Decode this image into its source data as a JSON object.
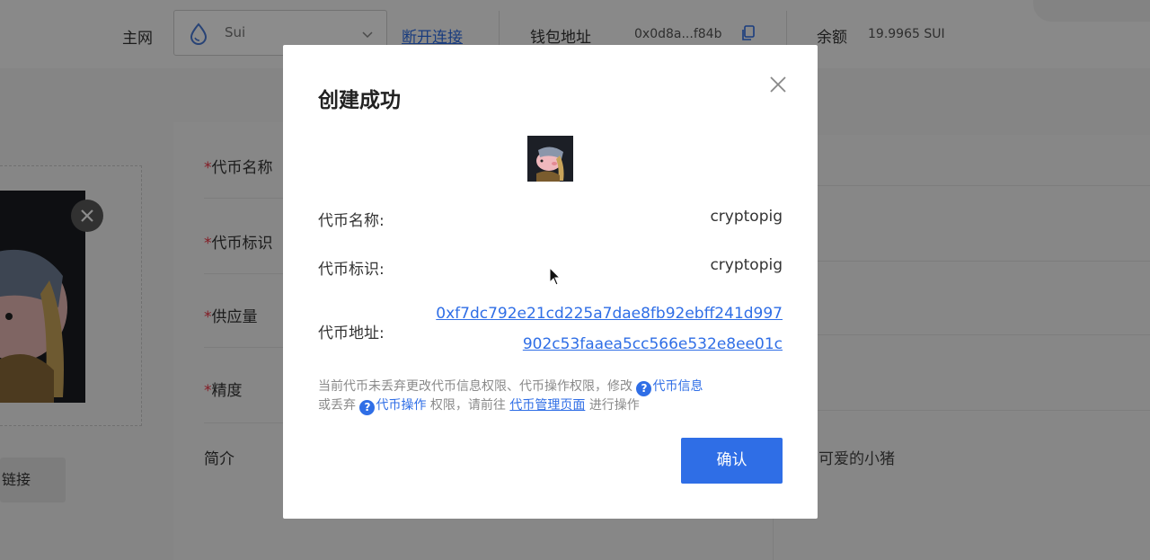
{
  "header": {
    "network_label": "主网",
    "network_value": "Sui",
    "disconnect_label": "断开连接",
    "wallet_label": "钱包地址",
    "wallet_address": "0x0d8a...f84b",
    "balance_label": "余额",
    "balance_value": "19.9965 SUI"
  },
  "form": {
    "token_name_label": "代币名称",
    "token_symbol_label": "代币标识",
    "supply_label": "供应量",
    "precision_label": "精度",
    "intro_label": "简介",
    "intro_value": "可爱的小猪",
    "link_button": "链接",
    "required_mark": "*"
  },
  "modal": {
    "title": "创建成功",
    "name_label": "代币名称:",
    "name_value": "cryptopig",
    "symbol_label": "代币标识:",
    "symbol_value": "cryptopig",
    "address_label": "代币地址:",
    "address_line1": "0xf7dc792e21cd225a7dae8fb92ebff241d997",
    "address_line2": "902c53faaea5cc566e532e8ee01c",
    "notice_part1": "当前代币未丢弃更改代币信息权限、代币操作权限，修改",
    "notice_link_info": "代币信息",
    "notice_part2": "或丢弃",
    "notice_link_ops": "代币操作",
    "notice_part3": "权限，请前往",
    "notice_link_manage": "代币管理页面",
    "notice_part4": "进行操作",
    "help_glyph": "?",
    "confirm_label": "确认"
  },
  "colors": {
    "accent": "#2f6ee6",
    "required": "#e34"
  }
}
